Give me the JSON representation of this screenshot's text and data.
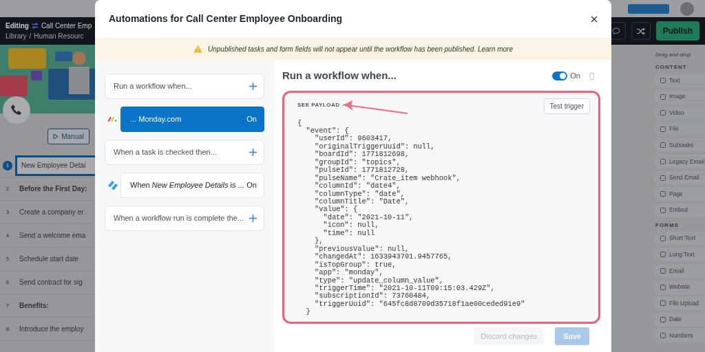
{
  "app_header": {
    "mode": "Editing",
    "workflow": "Call Center Emp",
    "breadcrumb": [
      "Library",
      "Human Resourc"
    ],
    "separator": "/",
    "publish": "Publish"
  },
  "tasks": [
    {
      "number": "1",
      "text": "New Employee Detai",
      "kind": "task",
      "selected": true
    },
    {
      "number": "2",
      "text": "Before the First Day:",
      "kind": "heading",
      "selected": false
    },
    {
      "number": "3",
      "text": "Create a company er",
      "kind": "task",
      "selected": false
    },
    {
      "number": "4",
      "text": "Send a welcome ema",
      "kind": "task",
      "selected": false
    },
    {
      "number": "5",
      "text": "Schedule start date",
      "kind": "task",
      "selected": false
    },
    {
      "number": "6",
      "text": "Send contract for sig",
      "kind": "task",
      "selected": false
    },
    {
      "number": "7",
      "text": "Benefits:",
      "kind": "heading",
      "selected": false
    },
    {
      "number": "8",
      "text": "Introduce the employ",
      "kind": "task",
      "selected": false
    }
  ],
  "manual_button": "Manual",
  "widgets": {
    "hint": "Drag and drop",
    "groups": [
      {
        "title": "CONTENT",
        "items": [
          "Text",
          "Image",
          "Video",
          "File",
          "Subtasks",
          "Legacy Email",
          "Send Email",
          "Page",
          "Embed"
        ]
      },
      {
        "title": "FORMS",
        "items": [
          "Short Text",
          "Long Text",
          "Email",
          "Website",
          "File Upload",
          "Date",
          "Numbers"
        ]
      }
    ]
  },
  "modal": {
    "title": "Automations for Call Center Employee Onboarding",
    "banner": {
      "message": "Unpublished tasks and form fields will not appear until the workflow has been published.",
      "link": "Learn more"
    },
    "rules": [
      {
        "kind": "section",
        "text": "Run a workflow when..."
      },
      {
        "kind": "trigger",
        "text": "... Monday.com",
        "status": "On",
        "selected": true
      },
      {
        "kind": "section",
        "text": "When a task is checked then..."
      },
      {
        "kind": "trigger",
        "text": "When *New Employee Details* is ...",
        "status": "On",
        "selected": false
      },
      {
        "kind": "section",
        "text": "When a workflow run is complete the..."
      }
    ],
    "detail": {
      "title": "Run a workflow when...",
      "toggle": {
        "on": true,
        "label": "On"
      },
      "payload": {
        "toggle_label": "SEE PAYLOAD",
        "expanded": true,
        "test_button": "Test trigger",
        "lines": [
          "{",
          "  \"event\": {",
          "    \"userId\": 9603417,",
          "    \"originalTriggerUuid\": null,",
          "    \"boardId\": 1771812698,",
          "    \"groupId\": \"topics\",",
          "    \"pulseId\": 1771812728,",
          "    \"pulseName\": \"Crate_item webhook\",",
          "    \"columnId\": \"date4\",",
          "    \"columnType\": \"date\",",
          "    \"columnTitle\": \"Date\",",
          "    \"value\": {",
          "      \"date\": \"2021-10-11\",",
          "      \"icon\": null,",
          "      \"time\": null",
          "    },",
          "    \"previousValue\": null,",
          "    \"changedAt\": 1633943701.9457765,",
          "    \"isTopGroup\": true,",
          "    \"app\": \"monday\",",
          "    \"type\": \"update_column_value\",",
          "    \"triggerTime\": \"2021-10-11T09:15:03.429Z\",",
          "    \"subscriptionId\": 73760484,",
          "    \"triggerUuid\": \"645fc8d8709d35718f1ae00ceded91e9\"",
          "  }"
        ]
      }
    },
    "footer": [
      {
        "label": "Discard changes",
        "kind": "secondary",
        "disabled": true
      },
      {
        "label": "Save",
        "kind": "primary",
        "disabled": true
      }
    ]
  }
}
